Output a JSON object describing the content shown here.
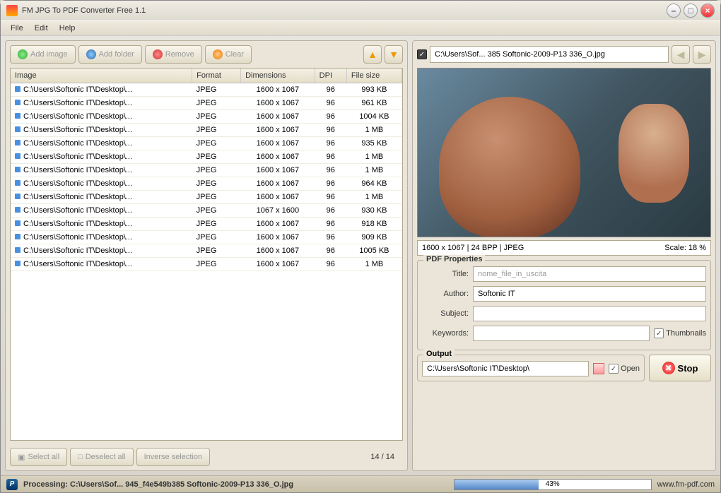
{
  "window": {
    "title": "FM JPG To PDF Converter Free 1.1"
  },
  "menus": {
    "file": "File",
    "edit": "Edit",
    "help": "Help"
  },
  "toolbar": {
    "add_image": "Add image",
    "add_folder": "Add folder",
    "remove": "Remove",
    "clear": "Clear"
  },
  "table": {
    "headers": {
      "image": "Image",
      "format": "Format",
      "dimensions": "Dimensions",
      "dpi": "DPI",
      "filesize": "File size"
    },
    "rows": [
      {
        "path": "C:\\Users\\Softonic IT\\Desktop\\...",
        "format": "JPEG",
        "dimensions": "1600 x 1067",
        "dpi": "96",
        "filesize": "993 KB"
      },
      {
        "path": "C:\\Users\\Softonic IT\\Desktop\\...",
        "format": "JPEG",
        "dimensions": "1600 x 1067",
        "dpi": "96",
        "filesize": "961 KB"
      },
      {
        "path": "C:\\Users\\Softonic IT\\Desktop\\...",
        "format": "JPEG",
        "dimensions": "1600 x 1067",
        "dpi": "96",
        "filesize": "1004 KB"
      },
      {
        "path": "C:\\Users\\Softonic IT\\Desktop\\...",
        "format": "JPEG",
        "dimensions": "1600 x 1067",
        "dpi": "96",
        "filesize": "1 MB"
      },
      {
        "path": "C:\\Users\\Softonic IT\\Desktop\\...",
        "format": "JPEG",
        "dimensions": "1600 x 1067",
        "dpi": "96",
        "filesize": "935 KB"
      },
      {
        "path": "C:\\Users\\Softonic IT\\Desktop\\...",
        "format": "JPEG",
        "dimensions": "1600 x 1067",
        "dpi": "96",
        "filesize": "1 MB"
      },
      {
        "path": "C:\\Users\\Softonic IT\\Desktop\\...",
        "format": "JPEG",
        "dimensions": "1600 x 1067",
        "dpi": "96",
        "filesize": "1 MB"
      },
      {
        "path": "C:\\Users\\Softonic IT\\Desktop\\...",
        "format": "JPEG",
        "dimensions": "1600 x 1067",
        "dpi": "96",
        "filesize": "964 KB"
      },
      {
        "path": "C:\\Users\\Softonic IT\\Desktop\\...",
        "format": "JPEG",
        "dimensions": "1600 x 1067",
        "dpi": "96",
        "filesize": "1 MB"
      },
      {
        "path": "C:\\Users\\Softonic IT\\Desktop\\...",
        "format": "JPEG",
        "dimensions": "1067 x 1600",
        "dpi": "96",
        "filesize": "930 KB"
      },
      {
        "path": "C:\\Users\\Softonic IT\\Desktop\\...",
        "format": "JPEG",
        "dimensions": "1600 x 1067",
        "dpi": "96",
        "filesize": "918 KB"
      },
      {
        "path": "C:\\Users\\Softonic IT\\Desktop\\...",
        "format": "JPEG",
        "dimensions": "1600 x 1067",
        "dpi": "96",
        "filesize": "909 KB"
      },
      {
        "path": "C:\\Users\\Softonic IT\\Desktop\\...",
        "format": "JPEG",
        "dimensions": "1600 x 1067",
        "dpi": "96",
        "filesize": "1005 KB"
      },
      {
        "path": "C:\\Users\\Softonic IT\\Desktop\\...",
        "format": "JPEG",
        "dimensions": "1600 x 1067",
        "dpi": "96",
        "filesize": "1 MB"
      }
    ],
    "count": "14 / 14"
  },
  "selection": {
    "select_all": "Select all",
    "deselect_all": "Deselect all",
    "inverse": "Inverse selection"
  },
  "preview": {
    "path": "C:\\Users\\Sof... 385 Softonic-2009-P13 336_O.jpg",
    "info_left": "1600 x 1067  |  24 BPP  |  JPEG",
    "info_right": "Scale: 18 %"
  },
  "pdf": {
    "legend": "PDF Properties",
    "title_label": "Title:",
    "title_value": "nome_file_in_uscita",
    "author_label": "Author:",
    "author_value": "Softonic IT",
    "subject_label": "Subject:",
    "subject_value": "",
    "keywords_label": "Keywords:",
    "keywords_value": "",
    "thumbnails": "Thumbnails"
  },
  "output": {
    "legend": "Output",
    "path": "C:\\Users\\Softonic IT\\Desktop\\",
    "open": "Open",
    "stop": "Stop"
  },
  "status": {
    "processing": "Processing: C:\\Users\\Sof... 945_f4e549b385 Softonic-2009-P13 336_O.jpg",
    "progress_pct": "43%",
    "website": "www.fm-pdf.com"
  }
}
